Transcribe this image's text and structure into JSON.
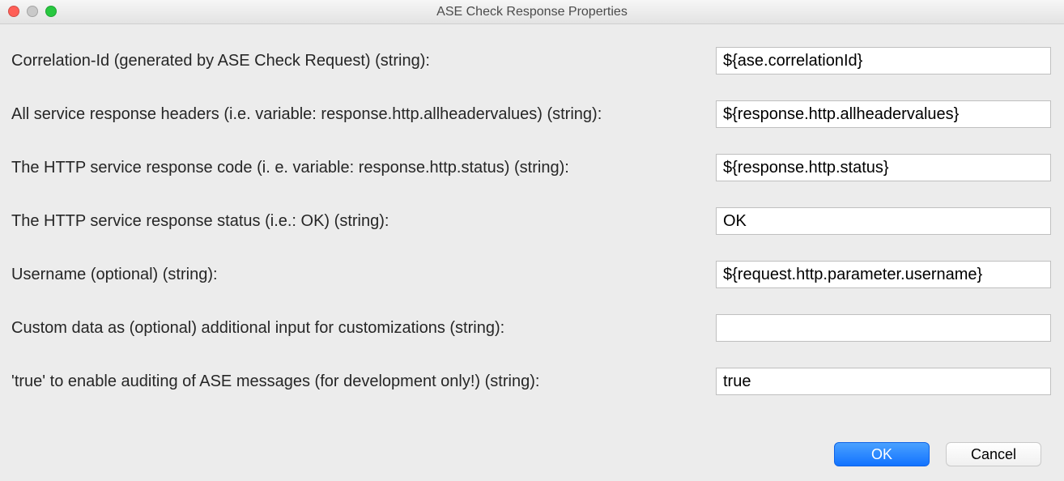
{
  "window": {
    "title": "ASE Check Response Properties"
  },
  "fields": {
    "correlation": {
      "label": "Correlation-Id (generated by ASE Check Request) (string):",
      "value": "${ase.correlationId}"
    },
    "headers": {
      "label": "All service response headers (i.e. variable: response.http.allheadervalues) (string):",
      "value": "${response.http.allheadervalues}"
    },
    "respCode": {
      "label": "The HTTP service response code (i. e. variable: response.http.status) (string):",
      "value": "${response.http.status}"
    },
    "respStatus": {
      "label": "The HTTP service response status (i.e.: OK) (string):",
      "value": "OK"
    },
    "username": {
      "label": "Username (optional) (string):",
      "value": "${request.http.parameter.username}"
    },
    "custom": {
      "label": "Custom data as (optional) additional input for customizations (string):",
      "value": ""
    },
    "audit": {
      "label": "'true' to enable auditing of ASE messages (for development only!) (string):",
      "value": "true"
    }
  },
  "buttons": {
    "ok": "OK",
    "cancel": "Cancel"
  }
}
